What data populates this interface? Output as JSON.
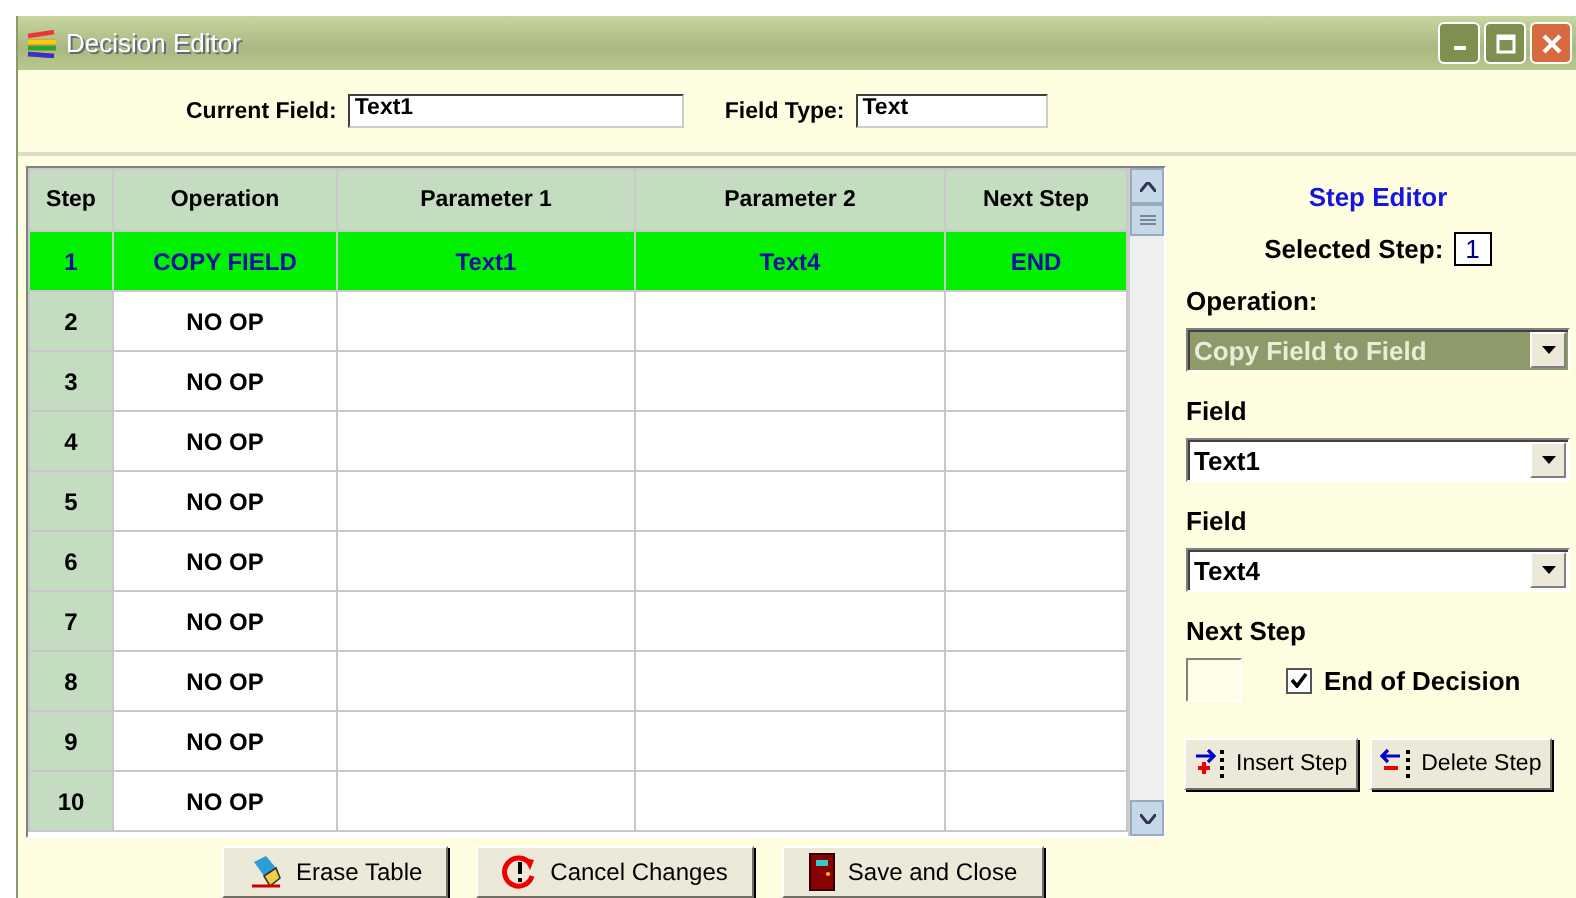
{
  "window": {
    "title": "Decision Editor"
  },
  "header": {
    "current_field_label": "Current Field:",
    "current_field": "Text1",
    "field_type_label": "Field Type:",
    "field_type": "Text"
  },
  "table": {
    "columns": [
      "Step",
      "Operation",
      "Parameter 1",
      "Parameter 2",
      "Next Step"
    ],
    "rows": [
      {
        "cells": [
          "1",
          "COPY FIELD",
          "Text1",
          "Text4",
          "END"
        ],
        "selected": true
      },
      {
        "cells": [
          "2",
          "NO OP"
        ],
        "selected": false
      },
      {
        "cells": [
          "3",
          "NO OP"
        ],
        "selected": false
      },
      {
        "cells": [
          "4",
          "NO OP"
        ],
        "selected": false
      },
      {
        "cells": [
          "5",
          "NO OP"
        ],
        "selected": false
      },
      {
        "cells": [
          "6",
          "NO OP"
        ],
        "selected": false
      },
      {
        "cells": [
          "7",
          "NO OP"
        ],
        "selected": false
      },
      {
        "cells": [
          "8",
          "NO OP"
        ],
        "selected": false
      },
      {
        "cells": [
          "9",
          "NO OP"
        ],
        "selected": false
      },
      {
        "cells": [
          "10",
          "NO OP"
        ],
        "selected": false
      }
    ]
  },
  "step_editor": {
    "title": "Step Editor",
    "selected_step_label": "Selected Step:",
    "selected_step": "1",
    "operation_label": "Operation:",
    "operation": "Copy Field to Field",
    "field1_label": "Field",
    "field1": "Text1",
    "field2_label": "Field",
    "field2": "Text4",
    "next_step_label": "Next Step",
    "end_of_decision": {
      "label": "End of Decision",
      "checked": true
    },
    "buttons": [
      "Insert Step",
      "Delete Step"
    ]
  },
  "buttons": [
    "Erase Table",
    "Cancel Changes",
    "Save and Close"
  ]
}
